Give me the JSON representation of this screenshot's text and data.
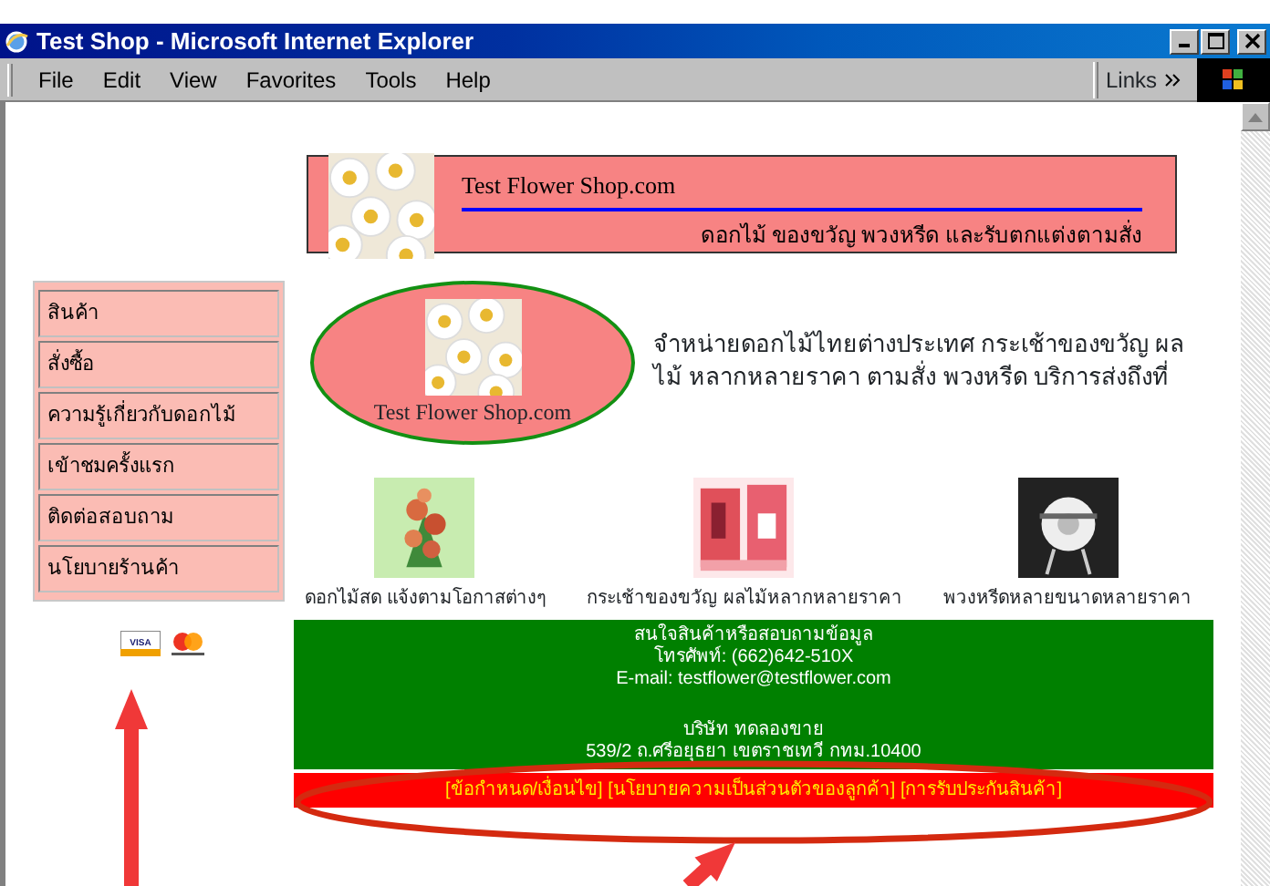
{
  "window": {
    "title": "Test Shop - Microsoft Internet Explorer"
  },
  "menu": [
    "File",
    "Edit",
    "View",
    "Favorites",
    "Tools",
    "Help"
  ],
  "links_label": "Links",
  "header": {
    "title": "Test  Flower Shop.com",
    "tagline": "ดอกไม้ ของขวัญ พวงหรีด และรับตกแต่งตามสั่ง"
  },
  "nav": [
    "สินค้า",
    "สั่งซื้อ",
    "ความรู้เกี่ยวกับดอกไม้",
    "เข้าชมครั้งแรก",
    "ติดต่อสอบถาม",
    "นโยบายร้านค้า"
  ],
  "payment": {
    "card_text": "VISA"
  },
  "logo_text": "Test Flower Shop.com",
  "intro": "จำหน่ายดอกไม้ไทยต่างประเทศ กระเช้าของขวัญ ผลไม้ หลากหลายราคา ตามสั่ง พวงหรีด บริการส่งถึงที่",
  "products": [
    {
      "kind": "bouquet",
      "caption": "ดอกไม้สด แจ้งตามโอกาสต่างๆ"
    },
    {
      "kind": "basket",
      "caption": "กระเช้าของขวัญ ผลไม้หลากหลายราคา"
    },
    {
      "kind": "wreath",
      "caption": "พวงหรีดหลายขนาดหลายราคา"
    }
  ],
  "contact": [
    "สนใจสินค้าหรือสอบถามข้อมูล",
    "โทรศัพท์: (662)642-510X",
    "E-mail: testflower@testflower.com"
  ],
  "address": [
    "บริษัท ทดลองขาย",
    "539/2 ถ.ศรีอยุธยา เขตราชเทวี กทม.10400"
  ],
  "footer_links": [
    "[ข้อกำหนด/เงื่อนไข]",
    "[นโยบายความเป็นส่วนตัวของลูกค้า]",
    "[การรับประกันสินค้า]"
  ],
  "annotations": [
    {
      "kind": "ellipse"
    },
    {
      "kind": "arrow"
    },
    {
      "kind": "arrow"
    }
  ]
}
